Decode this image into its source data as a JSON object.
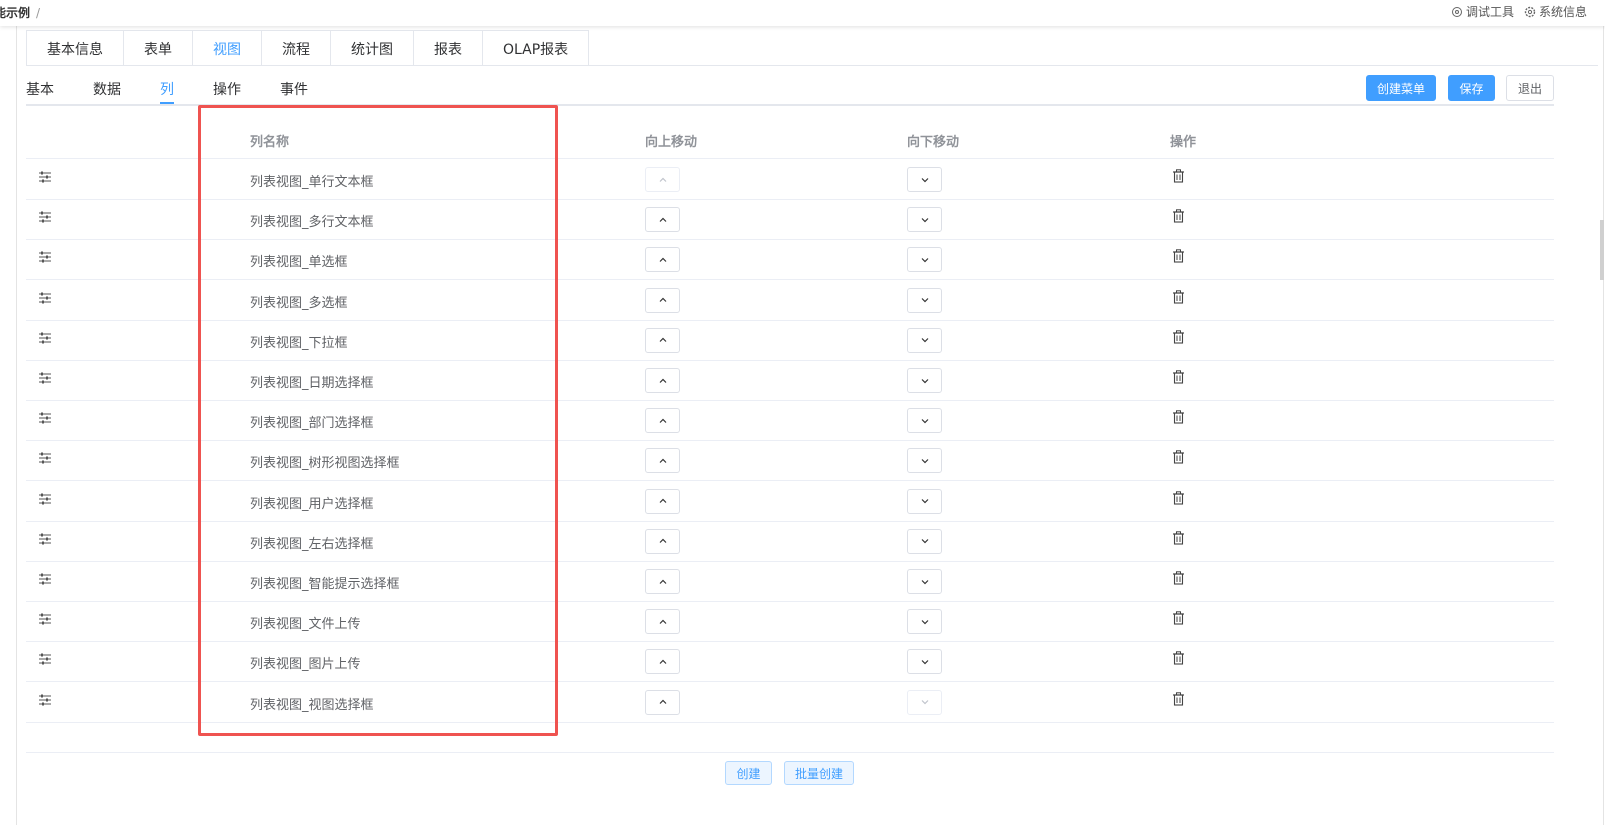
{
  "header": {
    "breadcrumb": "能示例",
    "breadcrumb_sep": "/",
    "debug_tool": "调试工具",
    "system_info": "系统信息"
  },
  "main_tabs": [
    {
      "label": "基本信息"
    },
    {
      "label": "表单"
    },
    {
      "label": "视图",
      "active": true
    },
    {
      "label": "流程"
    },
    {
      "label": "统计图"
    },
    {
      "label": "报表"
    },
    {
      "label": "OLAP报表"
    }
  ],
  "sub_tabs": [
    {
      "label": "基本"
    },
    {
      "label": "数据"
    },
    {
      "label": "列",
      "active": true
    },
    {
      "label": "操作"
    },
    {
      "label": "事件"
    }
  ],
  "actions": {
    "create_menu": "创建菜单",
    "save": "保存",
    "exit": "退出"
  },
  "table": {
    "headers": {
      "name": "列名称",
      "move_up": "向上移动",
      "move_down": "向下移动",
      "ops": "操作"
    },
    "rows": [
      {
        "name": "列表视图_单行文本框"
      },
      {
        "name": "列表视图_多行文本框"
      },
      {
        "name": "列表视图_单选框"
      },
      {
        "name": "列表视图_多选框"
      },
      {
        "name": "列表视图_下拉框"
      },
      {
        "name": "列表视图_日期选择框"
      },
      {
        "name": "列表视图_部门选择框"
      },
      {
        "name": "列表视图_树形视图选择框"
      },
      {
        "name": "列表视图_用户选择框"
      },
      {
        "name": "列表视图_左右选择框"
      },
      {
        "name": "列表视图_智能提示选择框"
      },
      {
        "name": "列表视图_文件上传"
      },
      {
        "name": "列表视图_图片上传"
      },
      {
        "name": "列表视图_视图选择框"
      }
    ]
  },
  "footer": {
    "create": "创建",
    "batch_create": "批量创建"
  },
  "colors": {
    "accent": "#409eff",
    "highlight_box": "#ef5350"
  }
}
